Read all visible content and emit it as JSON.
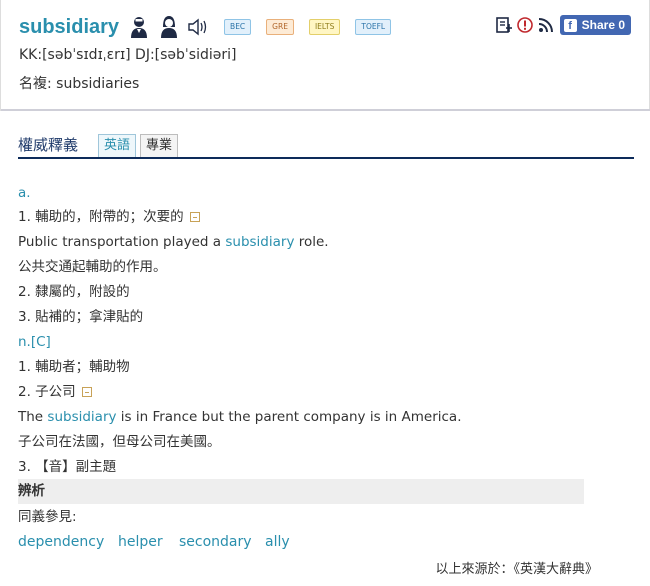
{
  "header": {
    "word": "subsidiary",
    "tags": [
      "BEC",
      "GRE",
      "IELTS",
      "TOEFL"
    ],
    "phonetic": "KK:[səbˈsɪdɪˌɛrɪ] DJ:[səbˈsidiəri]",
    "plural": "名複: subsidiaries",
    "share_label": "Share 0",
    "icons": [
      "male-voice-icon",
      "female-voice-icon",
      "speaker-icon",
      "wordbook-icon",
      "report-icon",
      "rss-icon",
      "facebook-icon"
    ]
  },
  "tabs": {
    "title": "權威釋義",
    "items": [
      "英語",
      "專業"
    ],
    "active": "英語"
  },
  "entries": {
    "adj_pos": "a.",
    "adj_sense1": "1. 輔助的，附帶的；次要的",
    "ex1_pre": "Public transportation played a ",
    "ex1_word": "subsidiary",
    "ex1_post": " role.",
    "ex1_zh": "公共交通起輔助的作用。",
    "adj_sense2": "2. 隸屬的，附設的",
    "adj_sense3": "3. 貼補的；拿津貼的",
    "noun_pos": "n.[C]",
    "noun_sense1": "1. 輔助者；輔助物",
    "noun_sense2": "2. 子公司",
    "ex2_pre": "The ",
    "ex2_word": "subsidiary",
    "ex2_post": " is in France but the parent company is in America.",
    "ex2_zh": "子公司在法國，但母公司在美國。",
    "noun_sense3": "3. 【音】副主題"
  },
  "analysis": {
    "title": "辨析",
    "synonym_label": "同義參見:",
    "synonyms": [
      "dependency",
      "helper",
      "secondary",
      "ally"
    ]
  },
  "source": "以上來源於：《英漢大辭典》",
  "colors": {
    "accent": "#2a8fad",
    "tab_line": "#0d2b5a",
    "facebook": "#4267b2"
  }
}
